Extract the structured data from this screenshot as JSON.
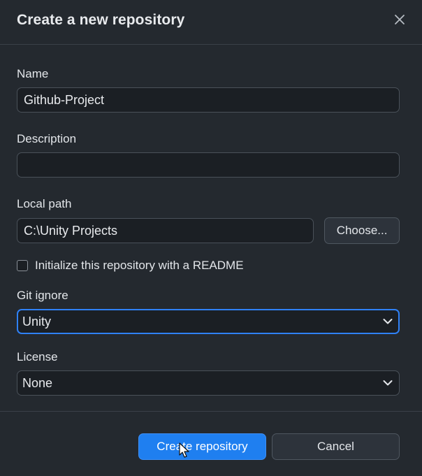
{
  "dialog": {
    "title": "Create a new repository",
    "close_icon": "close-icon"
  },
  "form": {
    "name": {
      "label": "Name",
      "value": "Github-Project"
    },
    "description": {
      "label": "Description",
      "value": ""
    },
    "local_path": {
      "label": "Local path",
      "value": "C:\\Unity Projects",
      "choose_label": "Choose..."
    },
    "readme": {
      "label": "Initialize this repository with a README",
      "checked": false
    },
    "git_ignore": {
      "label": "Git ignore",
      "selected": "Unity",
      "icon": "chevron-down-icon"
    },
    "license": {
      "label": "License",
      "selected": "None",
      "icon": "chevron-down-icon"
    }
  },
  "footer": {
    "create_label": "Create repository",
    "cancel_label": "Cancel"
  },
  "colors": {
    "background": "#24292f",
    "input_bg": "#1b1f24",
    "accent": "#2f81f7",
    "primary_button": "#1f7ff0"
  }
}
